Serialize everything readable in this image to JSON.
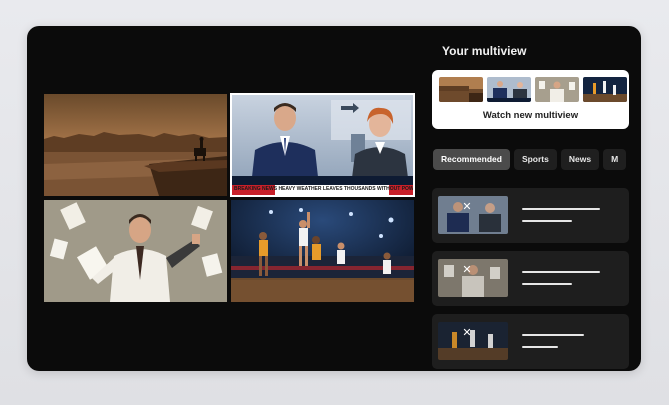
{
  "panel": {
    "title": "Your multiview",
    "card_label": "Watch new multiview"
  },
  "chips": [
    {
      "label": "Recommended",
      "active": true
    },
    {
      "label": "Sports",
      "active": false
    },
    {
      "label": "News",
      "active": false
    },
    {
      "label": "M",
      "active": false
    }
  ],
  "tiles": [
    {
      "name": "western-desert-tile",
      "selected": false
    },
    {
      "name": "news-anchors-tile",
      "selected": true
    },
    {
      "name": "office-man-tile",
      "selected": false
    },
    {
      "name": "basketball-tile",
      "selected": false
    }
  ],
  "news_ticker": "BREAKING NEWS  HEAVY WEATHER LEAVES THOUSANDS WITHOUT POWER  LIVE",
  "colors": {
    "screen_bg": "#0b0b0b",
    "card_bg": "#ffffff",
    "chip_active": "#4b4b4b",
    "chip_idle": "#1f1f1f",
    "row_bg": "#1e1e1e",
    "ticker_red": "#c8202a"
  }
}
